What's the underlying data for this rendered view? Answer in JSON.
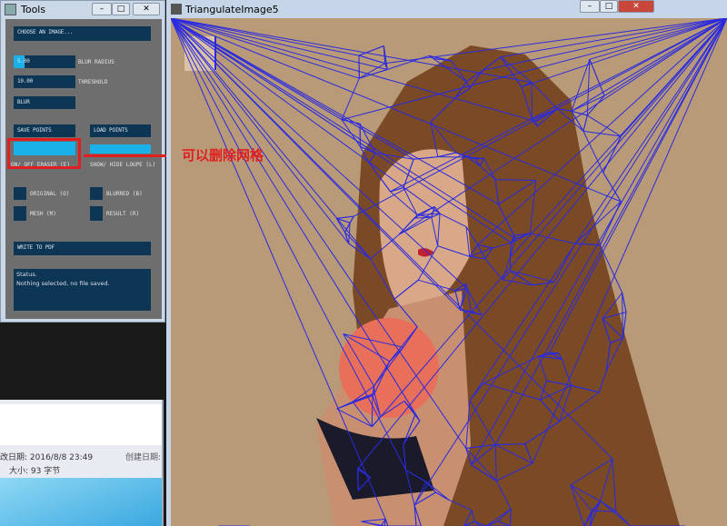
{
  "tools_window": {
    "title": "Tools",
    "choose_image": "CHOOSE AN IMAGE...",
    "blur_radius_value": "5.00",
    "blur_radius_label": "BLUR RADIUS",
    "threshold_value": "10.00",
    "threshold_label": "THRESHOLD",
    "blur_button": "BLUR",
    "save_points": "SAVE POINTS",
    "load_points": "LOAD POINTS",
    "eraser_label": "ON/ OFF ERASER (E)",
    "loupe_label": "SHOW/ HIDE LOUPE (L)",
    "views": [
      {
        "label": "ORIGINAL (O)",
        "checked": false
      },
      {
        "label": "BLURRED (B)",
        "checked": false
      },
      {
        "label": "MESH (M)",
        "checked": true
      },
      {
        "label": "RESULT (R)",
        "checked": false
      }
    ],
    "write_pdf": "WRITE TO PDF",
    "status_title": "Status.",
    "status_text": "Nothing selected, no file saved."
  },
  "annotation": {
    "text": "可以删除网格",
    "color": "#e02020"
  },
  "main_window": {
    "title": "TriangulateImage5"
  },
  "explorer": {
    "modified": "改日期: 2016/8/8 23:49",
    "created": "创建日期:",
    "size": "大小: 93 字节"
  },
  "colors": {
    "accent": "#1ab0e8",
    "button": "#0d3554",
    "mesh": "#2a2adf"
  }
}
